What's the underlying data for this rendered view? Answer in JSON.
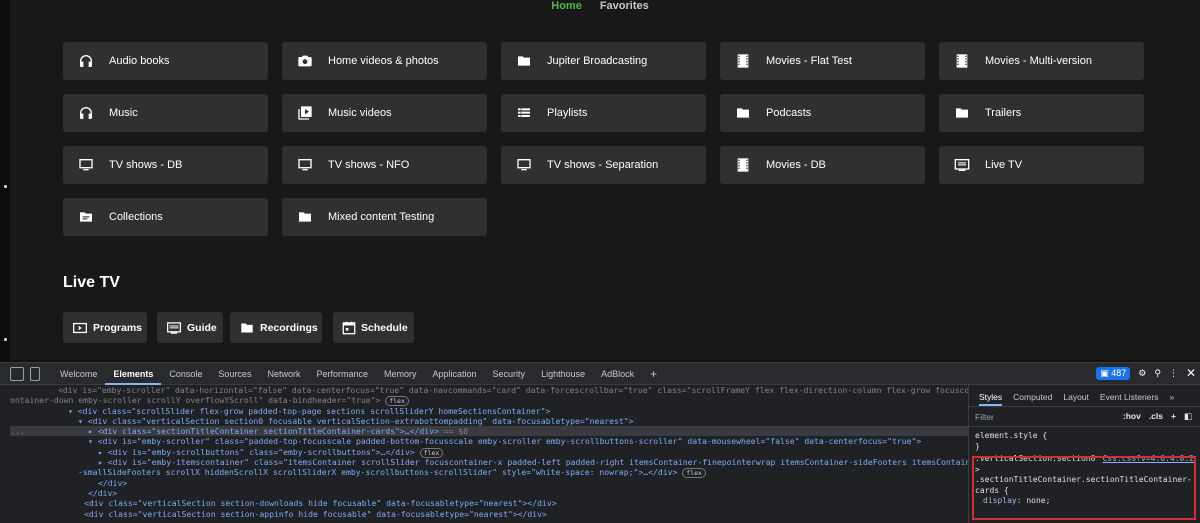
{
  "app": {
    "nav": {
      "home": "Home",
      "favorites": "Favorites"
    },
    "libraries": [
      {
        "label": "Audio books",
        "icon": "headphones-icon"
      },
      {
        "label": "Home videos & photos",
        "icon": "camera-icon"
      },
      {
        "label": "Jupiter Broadcasting",
        "icon": "folder-icon"
      },
      {
        "label": "Movies - Flat Test",
        "icon": "film-icon"
      },
      {
        "label": "Movies - Multi-version",
        "icon": "film-icon"
      },
      {
        "label": "Music",
        "icon": "headphones-icon"
      },
      {
        "label": "Music videos",
        "icon": "video-library-icon"
      },
      {
        "label": "Playlists",
        "icon": "playlist-icon"
      },
      {
        "label": "Podcasts",
        "icon": "folder-icon"
      },
      {
        "label": "Trailers",
        "icon": "folder-icon"
      },
      {
        "label": "TV shows - DB",
        "icon": "tv-icon"
      },
      {
        "label": "TV shows - NFO",
        "icon": "tv-icon"
      },
      {
        "label": "TV shows - Separation",
        "icon": "tv-icon"
      },
      {
        "label": "Movies - DB",
        "icon": "film-icon"
      },
      {
        "label": "Live TV",
        "icon": "live-tv-icon"
      },
      {
        "label": "Collections",
        "icon": "collection-icon"
      },
      {
        "label": "Mixed content Testing",
        "icon": "folder-icon"
      }
    ],
    "live_tv": {
      "title": "Live TV",
      "buttons": [
        {
          "label": "Programs",
          "icon": "live-tv-icon"
        },
        {
          "label": "Guide",
          "icon": "guide-icon"
        },
        {
          "label": "Recordings",
          "icon": "folder-icon"
        },
        {
          "label": "Schedule",
          "icon": "calendar-icon"
        }
      ]
    }
  },
  "devtools": {
    "tabs": [
      "Welcome",
      "Elements",
      "Console",
      "Sources",
      "Network",
      "Performance",
      "Memory",
      "Application",
      "Security",
      "Lighthouse",
      "AdBlock"
    ],
    "active_tab": "Elements",
    "issues_count": "487",
    "side_tabs": [
      "Styles",
      "Computed",
      "Layout",
      "Event Listeners"
    ],
    "filter_placeholder": "Filter",
    "filter_tools": {
      "hov": ":hov",
      "cls": ".cls",
      "plus": "+"
    },
    "style_lines": {
      "element_style": "element.style {",
      "close1": "}",
      "selector1": ".verticalSection.section0",
      "source": "Css.css?v=4.6.4.0:2",
      "gt": ">",
      "selector2": ".sectionTitleContainer.sectionTitleContainer-",
      "selector3": "cards {",
      "prop": "display",
      "value": "none;"
    },
    "dom_lines": [
      "<div is=\"emby-scroller\" data-horizontal=\"false\" data-centerfocus=\"true\" data-navcommands=\"card\" data-forcescrollbar=\"true\" class=\"scrollFrameY flex flex-direction-column flex-grow focuscontainer-down emby-scroller scrollY overflowYScroll\" data-bindheader=\"true\">",
      "<div class=\"scrollSlider flex-grow padded-top-page sections scrollSliderY homeSectionsContainer\">",
      "<div class=\"verticalSection section0 focusable verticalSection-extrabottompadding\" data-focusabletype=\"nearest\">",
      "<div class=\"sectionTitleContainer sectionTitleContainer-cards\">…</div>",
      "<div is=\"emby-scroller\" class=\"padded-top-focusscale padded-bottom-focusscale emby-scroller emby-scrollbuttons-scroller\" data-mousewheel=\"false\" data-centerfocus=\"true\">",
      "<div is=\"emby-scrollbuttons\" class=\"emby-scrollbuttons\">…</div>",
      "<div is=\"emby-itemscontainer\" class=\"itemsContainer scrollSlider focuscontainer-x padded-left padded-right itemsContainer-finepointerwrap itemsContainer-sideFooters itemsContainer-smallSideFooters scrollX hiddenScrollX scrollSliderX emby-scrollbuttons-scrollSlider\" style=\"white-space: nowrap;\">…</div>",
      "</div>",
      "</div>",
      "<div class=\"verticalSection section-downloads hide focusable\" data-focusabletype=\"nearest\"></div>",
      "<div class=\"verticalSection section-appinfo hide focusable\" data-focusabletype=\"nearest\"></div>"
    ]
  }
}
